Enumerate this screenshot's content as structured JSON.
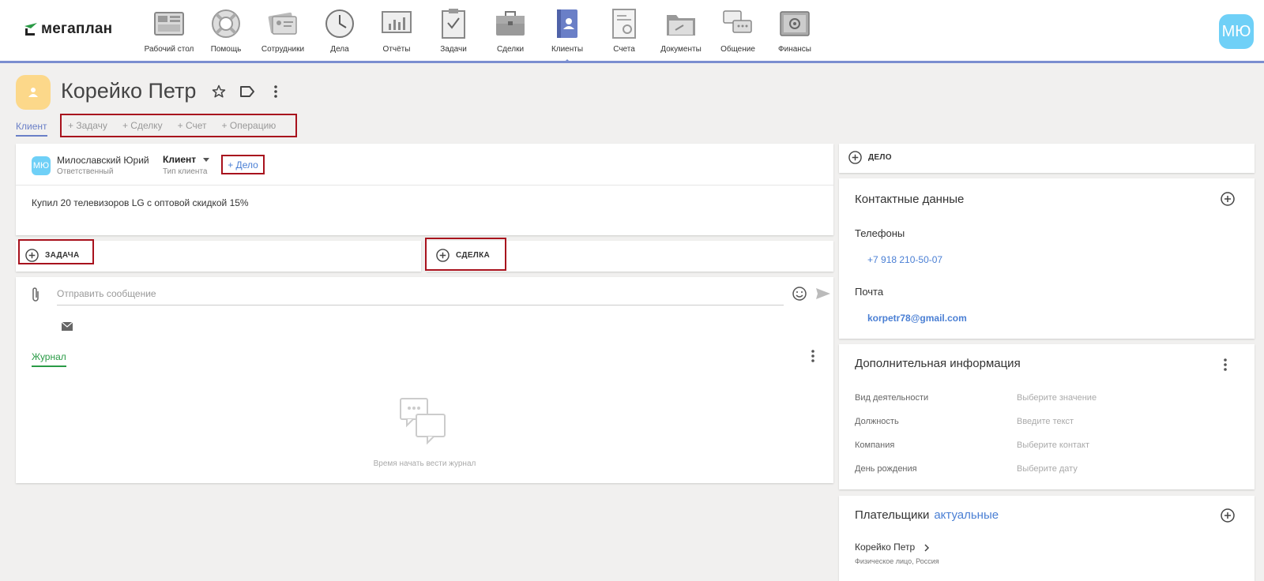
{
  "app": {
    "logo_text": "мегаплан",
    "user_initials": "МЮ"
  },
  "nav": [
    {
      "label": "Рабочий стол",
      "icon": "desktop-icon"
    },
    {
      "label": "Помощь",
      "icon": "lifebuoy-icon"
    },
    {
      "label": "Сотрудники",
      "icon": "employees-icon"
    },
    {
      "label": "Дела",
      "icon": "clock-icon"
    },
    {
      "label": "Отчёты",
      "icon": "reports-icon"
    },
    {
      "label": "Задачи",
      "icon": "tasks-icon"
    },
    {
      "label": "Сделки",
      "icon": "briefcase-icon"
    },
    {
      "label": "Клиенты",
      "icon": "clients-icon",
      "active": true
    },
    {
      "label": "Счета",
      "icon": "invoice-icon"
    },
    {
      "label": "Документы",
      "icon": "folder-icon"
    },
    {
      "label": "Общение",
      "icon": "chat-icon"
    },
    {
      "label": "Финансы",
      "icon": "safe-icon"
    }
  ],
  "header": {
    "title": "Корейко Петр",
    "tab_client": "Клиент",
    "actions": [
      "+ Задачу",
      "+ Сделку",
      "+ Счет",
      "+ Операцию"
    ]
  },
  "main_card": {
    "responsible_initials": "МЮ",
    "responsible_name": "Милославский Юрий",
    "responsible_label": "Ответственный",
    "client_type": "Клиент",
    "client_type_label": "Тип клиента",
    "add_delo": "+ Дело",
    "note": "Купил 20 телевизоров LG с оптовой скидкой 15%"
  },
  "task_card": {
    "label": "ЗАДАЧА"
  },
  "deal_card": {
    "label": "СДЕЛКА"
  },
  "message": {
    "placeholder": "Отправить сообщение",
    "journal_tab": "Журнал",
    "empty_text": "Время начать вести журнал"
  },
  "right": {
    "delo_label": "ДЕЛО",
    "contacts_title": "Контактные данные",
    "phones_label": "Телефоны",
    "phone": "+7 918 210-50-07",
    "email_label": "Почта",
    "email": "korpetr78@gmail.com",
    "extra_title": "Дополнительная информация",
    "extra_fields": [
      {
        "key": "Вид деятельности",
        "value": "Выберите значение"
      },
      {
        "key": "Должность",
        "value": "Введите текст"
      },
      {
        "key": "Компания",
        "value": "Выберите контакт"
      },
      {
        "key": "День рождения",
        "value": "Выберите дату"
      }
    ],
    "payers_title": "Плательщики",
    "payers_filter": "актуальные",
    "payer_name": "Корейко Петр",
    "payer_sub": "Физическое лицо, Россия"
  }
}
